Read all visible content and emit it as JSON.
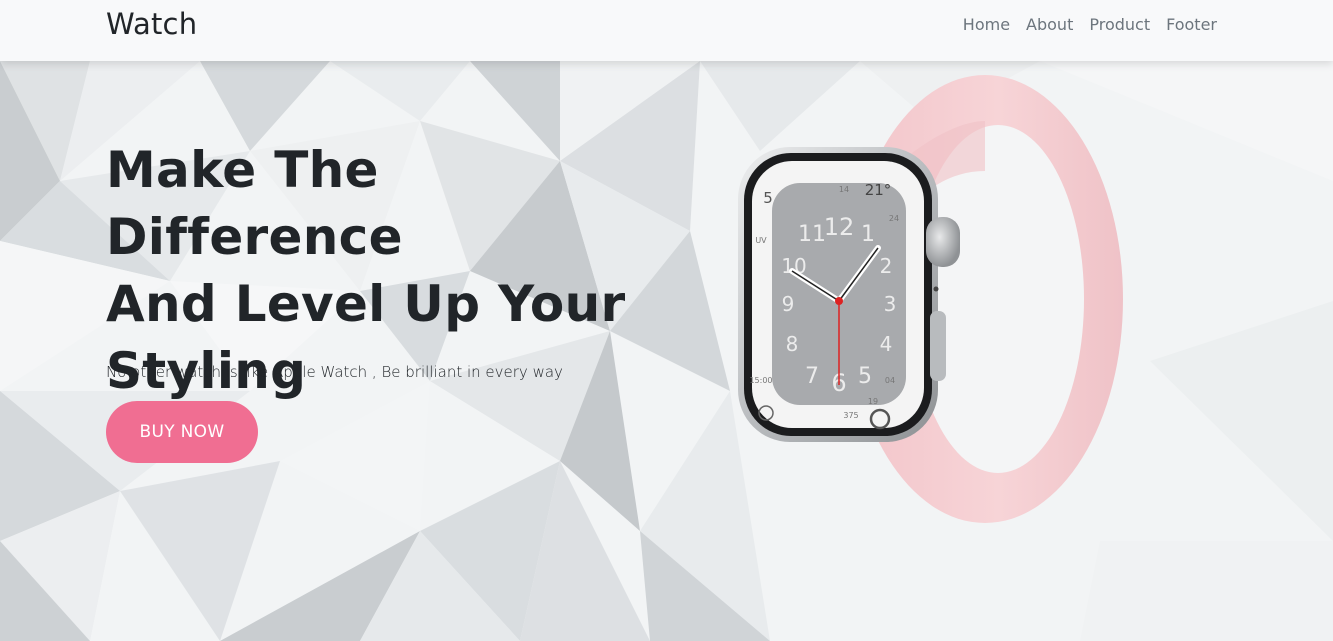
{
  "navbar": {
    "brand": "Watch",
    "links": [
      "Home",
      "About",
      "Product",
      "Footer"
    ]
  },
  "hero": {
    "headline_lines": [
      "Make The Difference",
      "And Level Up Your",
      "Styling"
    ],
    "tagline": "No other watch is like Apple Watch , Be brilliant in every way",
    "cta_label": "BUY NOW"
  },
  "watch_face": {
    "numerals": [
      "11",
      "12",
      "1",
      "2",
      "3",
      "4",
      "5",
      "6",
      "7",
      "8",
      "9",
      "10"
    ],
    "corner_top_left": "5",
    "corner_top_right": "21°",
    "small_top": "14",
    "small_right": "24",
    "left_label": "UV",
    "bottom_left": "15:00",
    "bottom_right_a": "375",
    "bottom_right_b": "19",
    "bottom_right_c": "04"
  },
  "colors": {
    "accent": "#f06e92",
    "band": "#f5cfd3",
    "case": "#c9cbce",
    "dial": "#a8aaad"
  }
}
